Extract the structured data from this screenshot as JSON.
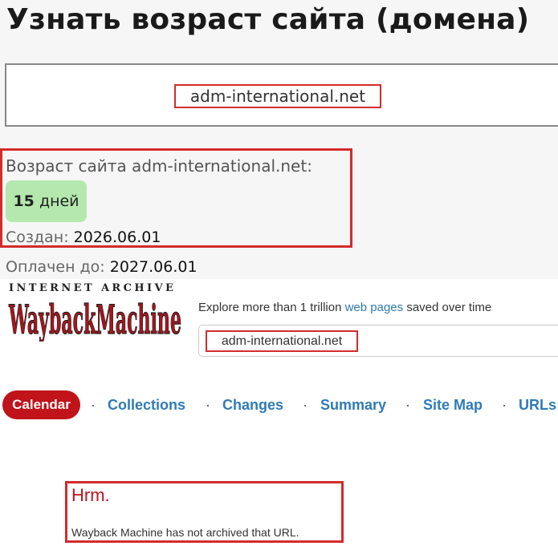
{
  "age_checker": {
    "title": "Узнать возраст сайта (домена)",
    "domain": "adm-international.net",
    "result_label": "Возраст сайта adm-international.net:",
    "days_number": "15",
    "days_unit": "дней",
    "created_label": "Создан:",
    "created_value": "2026.06.01",
    "paid_label": "Оплачен до:",
    "paid_value": "2027.06.01"
  },
  "wayback": {
    "ia_text": "INTERNET ARCHIVE",
    "logo_text": "WaybackMachine",
    "tagline_before": "Explore more than 1 trillion",
    "tagline_link": "web pages",
    "tagline_after": "saved over time",
    "url_value": "adm-international.net",
    "tabs": [
      "Calendar",
      "Collections",
      "Changes",
      "Summary",
      "Site Map",
      "URLs"
    ],
    "separator": "·",
    "hrm": "Hrm.",
    "message": "Wayback Machine has not archived that URL."
  },
  "colors": {
    "highlight_border": "#d42b2b",
    "badge_green": "#b5e8ae",
    "calendar_red": "#c1131a",
    "link_blue": "#2f7bb6"
  }
}
